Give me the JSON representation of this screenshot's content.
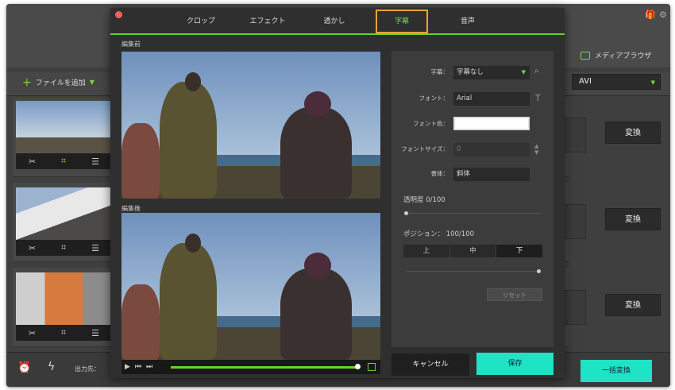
{
  "app": {
    "add_file": "ファイルを追加",
    "media_browser": "メディアブラウザ",
    "format": "AVI",
    "convert_label": "変換",
    "output_label": "出力先：",
    "batch_convert": "一括変換"
  },
  "tabs": [
    "クロップ",
    "エフェクト",
    "透かし",
    "字幕",
    "音声"
  ],
  "active_tab": "字幕",
  "editor": {
    "before_label": "編集前",
    "after_label": "編集後"
  },
  "subtitle_panel": {
    "subtitle_label": "字幕：",
    "subtitle_value": "字幕なし",
    "font_label": "フォント：",
    "font_value": "Arial",
    "font_color_label": "フォント色：",
    "font_color_value": "#ffffff",
    "font_size_label": "フォントサイズ：",
    "font_size_value": "0",
    "style_label": "書体：",
    "style_value": "斜体",
    "transparency_label": "透明度 0/100",
    "position_label": "ポジション： 100/100",
    "position_options": [
      "上",
      "中",
      "下"
    ],
    "position_selected": "下",
    "reset": "リセット"
  },
  "buttons": {
    "cancel": "キャンセル",
    "save": "保存"
  },
  "colors": {
    "accent_green": "#6ad32a",
    "save_teal": "#1ee3c4",
    "active_tab_border": "#f0a135"
  }
}
